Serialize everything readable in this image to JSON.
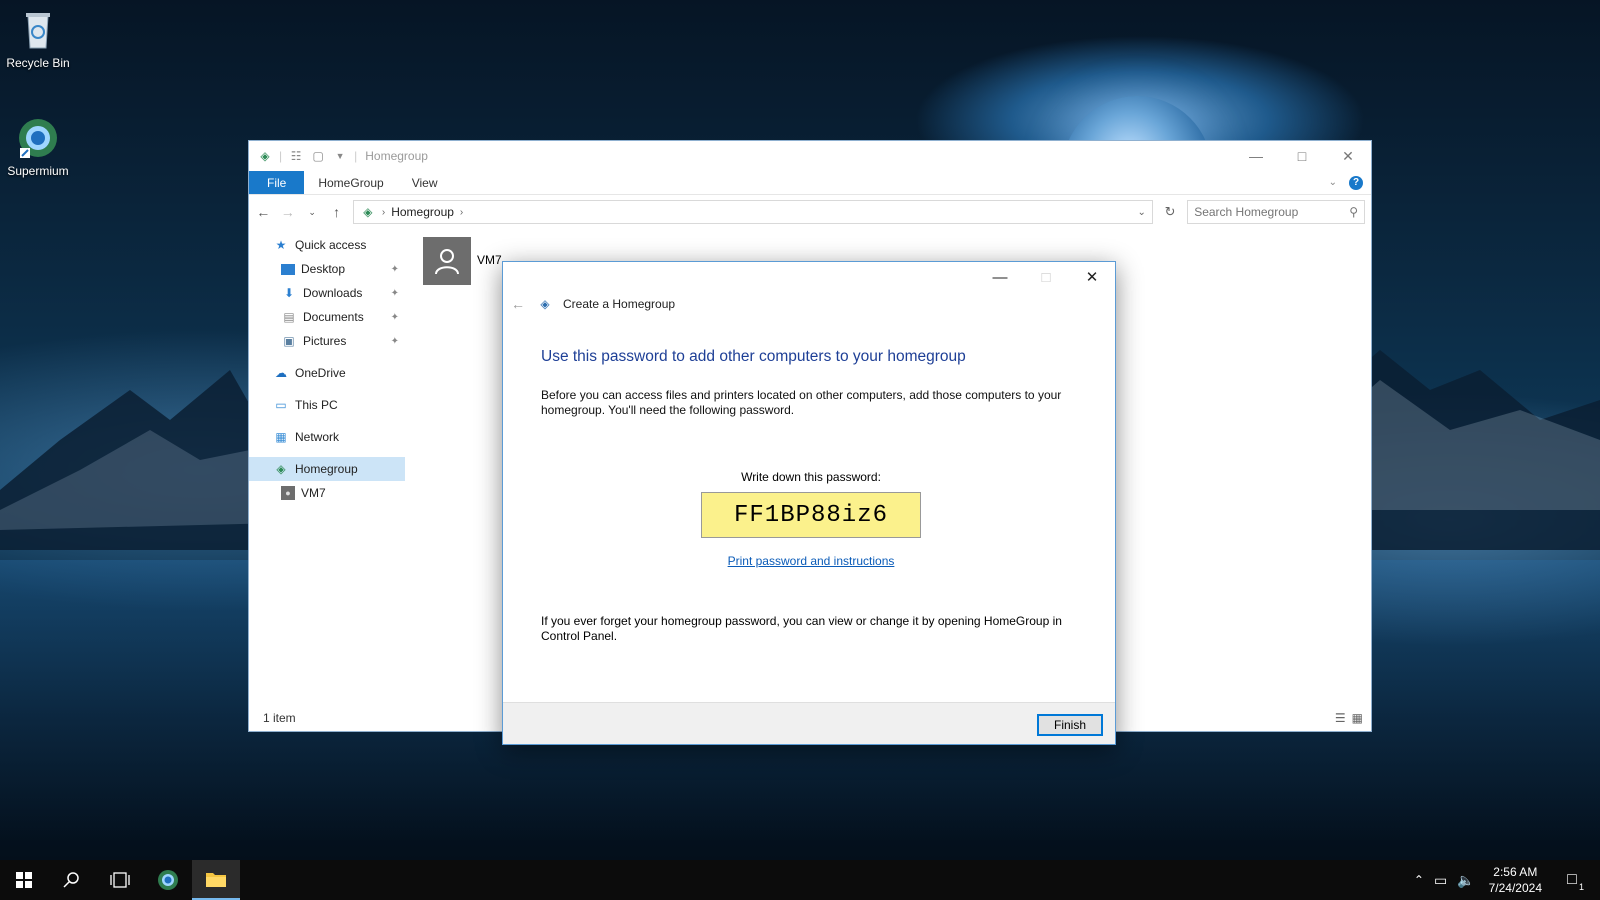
{
  "desktop": {
    "icons": [
      {
        "label": "Recycle Bin",
        "icon": "recycle-bin-icon"
      },
      {
        "label": "Supermium",
        "icon": "supermium-browser-icon"
      }
    ]
  },
  "explorer": {
    "title": "Homegroup",
    "ribbon_tabs": [
      "File",
      "HomeGroup",
      "View"
    ],
    "address": {
      "crumb": "Homegroup"
    },
    "search": {
      "placeholder": "Search Homegroup"
    },
    "nav": {
      "quick_access": "Quick access",
      "pinned": [
        "Desktop",
        "Downloads",
        "Documents",
        "Pictures"
      ],
      "onedrive": "OneDrive",
      "this_pc": "This PC",
      "network": "Network",
      "homegroup": "Homegroup",
      "homegroup_child": "VM7"
    },
    "content": {
      "item_label": "VM7"
    },
    "status": "1 item"
  },
  "dialog": {
    "title": "Create a Homegroup",
    "heading": "Use this password to add other computers to your homegroup",
    "paragraph1": "Before you can access files and printers located on other computers, add those computers to your homegroup. You'll need the following password.",
    "password_label": "Write down this password:",
    "password": "FF1BP88iz6",
    "print_link": "Print password and instructions",
    "paragraph2": "If you ever forget your homegroup password, you can view or change it by opening HomeGroup in Control Panel.",
    "finish_label": "Finish"
  },
  "taskbar": {
    "time": "2:56 AM",
    "date": "7/24/2024",
    "notification_count": "1"
  }
}
